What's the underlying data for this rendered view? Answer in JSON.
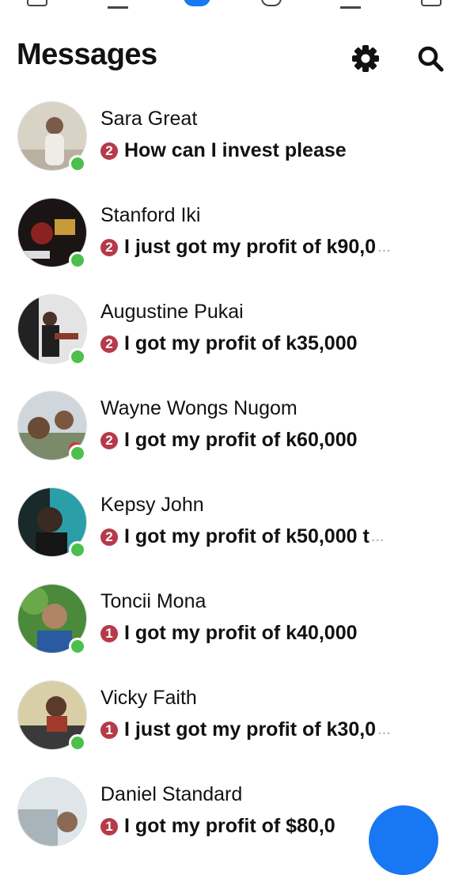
{
  "header": {
    "title": "Messages",
    "settings_icon": "gear-icon",
    "search_icon": "search-icon"
  },
  "colors": {
    "accent": "#1877f2",
    "badge": "#b53a4a",
    "online": "#4cbf4c"
  },
  "conversations": [
    {
      "name": "Sara Great",
      "badge": "2",
      "preview": "How can I invest please",
      "truncated": ""
    },
    {
      "name": "Stanford Iki",
      "badge": "2",
      "preview": "I just got my profit of k90,0",
      "truncated": "..."
    },
    {
      "name": "Augustine Pukai",
      "badge": "2",
      "preview": "I got my profit of k35,000",
      "truncated": ""
    },
    {
      "name": "Wayne Wongs Nugom",
      "badge": "2",
      "preview": "I got my profit of k60,000",
      "truncated": ""
    },
    {
      "name": "Kepsy John",
      "badge": "2",
      "preview": "I got my profit of k50,000 t",
      "truncated": "..."
    },
    {
      "name": "Toncii Mona",
      "badge": "1",
      "preview": "I got my profit of k40,000",
      "truncated": ""
    },
    {
      "name": "Vicky Faith",
      "badge": "1",
      "preview": "I just got my profit of k30,0",
      "truncated": "..."
    },
    {
      "name": "Daniel Standard",
      "badge": "1",
      "preview": "I got  my profit of $80,0",
      "truncated": ""
    }
  ]
}
